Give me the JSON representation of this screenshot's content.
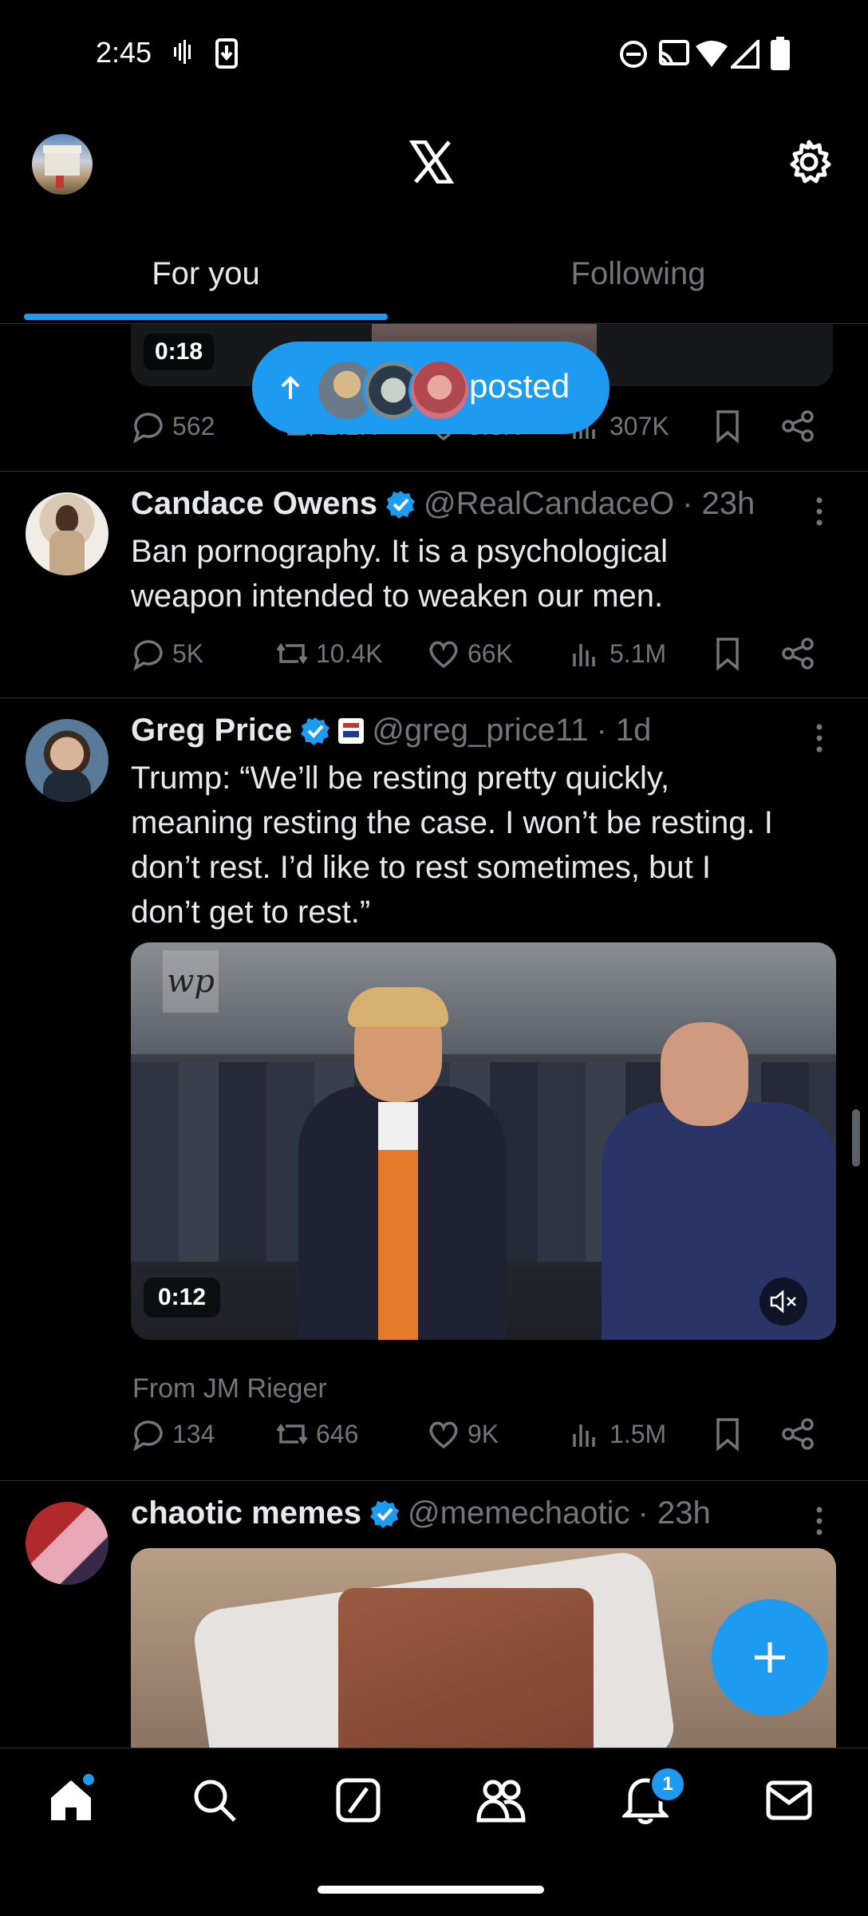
{
  "status": {
    "time": "2:45"
  },
  "header": {
    "logo": "X",
    "tabs": [
      {
        "label": "For you"
      },
      {
        "label": "Following"
      }
    ]
  },
  "pill": {
    "label": "posted"
  },
  "partial_tweet": {
    "duration": "0:18",
    "reply": "562",
    "repost": "2.2K",
    "like": "3.3K",
    "views": "307K"
  },
  "tweets": [
    {
      "name": "Candace Owens",
      "handle": "@RealCandaceO",
      "time": "· 23h",
      "text_lines": [
        "Ban pornography. It is a psychological",
        "weapon intended to weaken our men."
      ],
      "reply": "5K",
      "repost": "10.4K",
      "like": "66K",
      "views": "5.1M"
    },
    {
      "name": "Greg Price",
      "handle": "@greg_price11",
      "time": "· 1d",
      "text_lines": [
        "Trump: “We’ll be resting pretty quickly,",
        "meaning resting the case. I won’t be resting. I",
        "don’t rest. I’d like to rest sometimes, but I",
        "don’t get to rest.”"
      ],
      "video_duration": "0:12",
      "watermark": "wp",
      "from": "From JM Rieger",
      "reply": "134",
      "repost": "646",
      "like": "9K",
      "views": "1.5M"
    },
    {
      "name": "chaotic memes",
      "handle": "@memechaotic",
      "time": "· 23h"
    }
  ],
  "bottom_nav": {
    "items": [
      "home-icon",
      "search-icon",
      "grok-icon",
      "communities-icon",
      "notifications-icon",
      "messages-icon"
    ],
    "notification_count": "1"
  },
  "colors": {
    "accent": "#1d9bf0",
    "background": "#000000",
    "muted": "#71767b",
    "text": "#e7e9ea"
  }
}
